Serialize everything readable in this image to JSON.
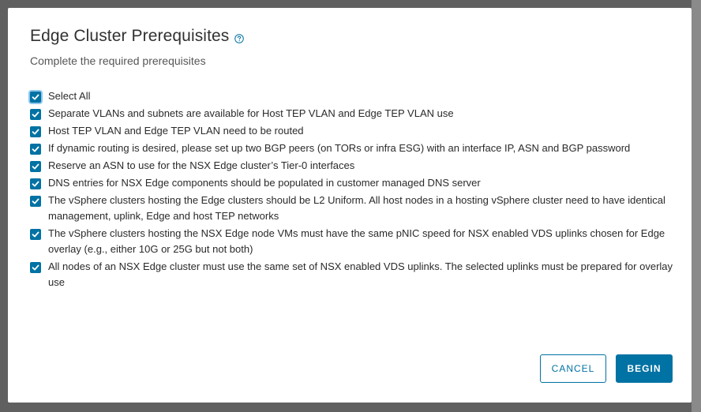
{
  "dialog": {
    "title": "Edge Cluster Prerequisites",
    "subtitle": "Complete the required prerequisites",
    "help_icon": "question-circle-icon"
  },
  "prerequisites": [
    {
      "label": "Select All",
      "checked": true
    },
    {
      "label": "Separate VLANs and subnets are available for Host TEP VLAN and Edge TEP VLAN use",
      "checked": true
    },
    {
      "label": "Host TEP VLAN and Edge TEP VLAN need to be routed",
      "checked": true
    },
    {
      "label": "If dynamic routing is desired, please set up two BGP peers (on TORs or infra ESG) with an interface IP, ASN and BGP password",
      "checked": true
    },
    {
      "label": "Reserve an ASN to use for the NSX Edge cluster’s Tier-0 interfaces",
      "checked": true
    },
    {
      "label": "DNS entries for NSX Edge components should be populated in customer managed DNS server",
      "checked": true
    },
    {
      "label": "The vSphere clusters hosting the Edge clusters should be L2 Uniform. All host nodes in a hosting vSphere cluster need to have identical management, uplink, Edge and host TEP networks",
      "checked": true
    },
    {
      "label": "The vSphere clusters hosting the NSX Edge node VMs must have the same pNIC speed for NSX enabled VDS uplinks chosen for Edge overlay (e.g., either 10G or 25G but not both)",
      "checked": true
    },
    {
      "label": "All nodes of an NSX Edge cluster must use the same set of NSX enabled VDS uplinks. The selected uplinks must be prepared for overlay use",
      "checked": true
    }
  ],
  "buttons": {
    "cancel": "CANCEL",
    "begin": "BEGIN"
  },
  "colors": {
    "accent": "#0072a3",
    "backdrop": "#606060"
  }
}
